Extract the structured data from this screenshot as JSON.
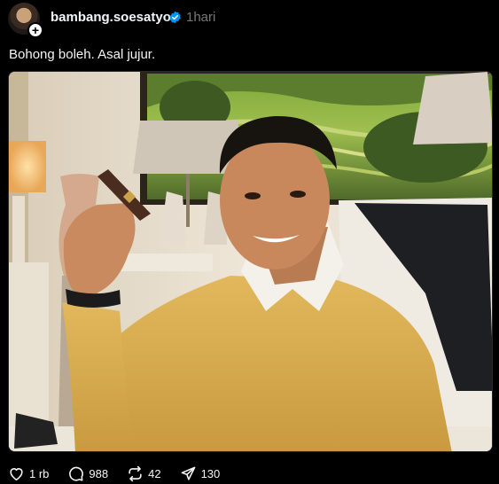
{
  "post": {
    "author": {
      "username": "bambang.soesatyo",
      "verified": true,
      "avatar_icon": "avatar-icon",
      "follow_icon": "plus-icon"
    },
    "timestamp": "1hari",
    "caption": "Bohong boleh. Asal jujur.",
    "actions": {
      "like_count": "1 rb",
      "comment_count": "988",
      "repost_count": "42",
      "share_count": "130"
    }
  },
  "colors": {
    "background": "#000000",
    "text": "#f3f5f7",
    "muted": "#777777",
    "verified": "#0095f6",
    "sweater": "#dcab4e"
  }
}
